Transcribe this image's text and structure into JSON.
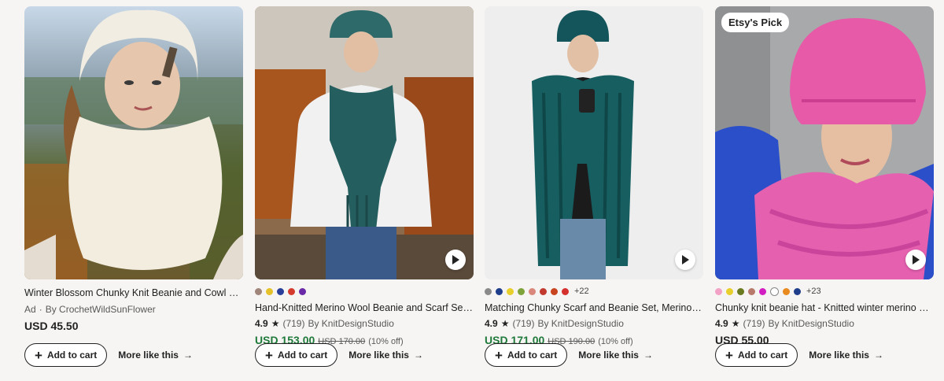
{
  "cards": [
    {
      "title": "Winter Blossom Chunky Knit Beanie and Cowl Sca...",
      "badge": "",
      "swatches": [],
      "swatch_more": "",
      "ad_label": "Ad",
      "shop": "By CrochetWildSunFlower",
      "rating": "",
      "reviews": "",
      "price": "USD 45.50",
      "orig_price": "",
      "discount": "",
      "add_to_cart": "Add to cart",
      "more_like_this": "More like this"
    },
    {
      "title": "Hand-Knitted Merino Wool Beanie and Scarf Set -...",
      "badge": "",
      "swatches": [
        "#a0867a",
        "#e5c12a",
        "#2a3f9a",
        "#d43b2e",
        "#6a2aa8"
      ],
      "swatch_more": "",
      "ad_label": "",
      "shop": "By KnitDesignStudio",
      "rating": "4.9",
      "reviews": "(719)",
      "price": "USD 153.00",
      "orig_price": "USD 170.00",
      "discount": "(10% off)",
      "add_to_cart": "Add to cart",
      "more_like_this": "More like this"
    },
    {
      "title": "Matching Chunky Scarf and Beanie Set, Merino W...",
      "badge": "",
      "swatches": [
        "#8a8a8a",
        "#1e3d8a",
        "#e8cf2b",
        "#7ea33a",
        "#d9887b",
        "#c23a2e",
        "#c8441f",
        "#d4302e"
      ],
      "swatch_more": "+22",
      "ad_label": "",
      "shop": "By KnitDesignStudio",
      "rating": "4.9",
      "reviews": "(719)",
      "price": "USD 171.00",
      "orig_price": "USD 190.00",
      "discount": "(10% off)",
      "add_to_cart": "Add to cart",
      "more_like_this": "More like this"
    },
    {
      "title": "Chunky knit beanie hat - Knitted winter merino wo...",
      "badge": "Etsy's Pick",
      "swatches": [
        "#f2a2c4",
        "#e8cf2b",
        "#6a7a1e",
        "#b87a6a",
        "#d31fc2",
        "#ffffff",
        "#e88a1e",
        "#1e3d8a"
      ],
      "swatch_more": "+23",
      "ad_label": "",
      "shop": "By KnitDesignStudio",
      "rating": "4.9",
      "reviews": "(719)",
      "price": "USD 55.00",
      "orig_price": "",
      "discount": "",
      "add_to_cart": "Add to cart",
      "more_like_this": "More like this"
    }
  ],
  "colors": {
    "sale_price": "#1f7a3b"
  }
}
